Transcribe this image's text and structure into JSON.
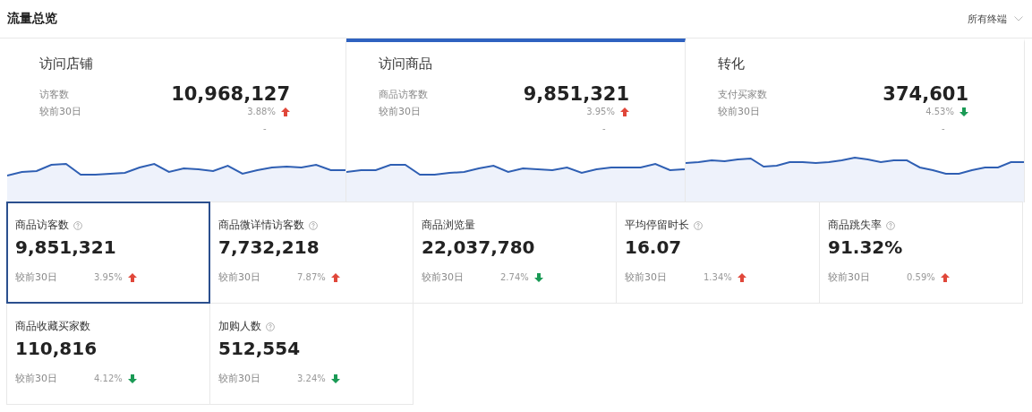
{
  "header": {
    "title": "流量总览",
    "filter": "所有终端"
  },
  "tabs": [
    {
      "title": "访问店铺",
      "metric": "访客数",
      "value": "10,968,127",
      "compare": "较前30日",
      "change": "3.88%",
      "rising": true,
      "note": "-",
      "selected": false
    },
    {
      "title": "访问商品",
      "metric": "商品访客数",
      "value": "9,851,321",
      "compare": "较前30日",
      "change": "3.95%",
      "rising": true,
      "note": "-",
      "selected": true
    },
    {
      "title": "转化",
      "metric": "支付买家数",
      "value": "374,601",
      "compare": "较前30日",
      "change": "4.53%",
      "rising": false,
      "note": "-",
      "selected": false
    }
  ],
  "metrics": [
    {
      "name": "商品访客数",
      "help": true,
      "value": "9,851,321",
      "compare": "较前30日",
      "change": "3.95%",
      "rising": true,
      "selected": true
    },
    {
      "name": "商品微详情访客数",
      "help": true,
      "value": "7,732,218",
      "compare": "较前30日",
      "change": "7.87%",
      "rising": true,
      "selected": false
    },
    {
      "name": "商品浏览量",
      "help": false,
      "value": "22,037,780",
      "compare": "较前30日",
      "change": "2.74%",
      "rising": false,
      "selected": false
    },
    {
      "name": "平均停留时长",
      "help": true,
      "value": "16.07",
      "compare": "较前30日",
      "change": "1.34%",
      "rising": true,
      "selected": false
    },
    {
      "name": "商品跳失率",
      "help": true,
      "value": "91.32%",
      "compare": "较前30日",
      "change": "0.59%",
      "rising": true,
      "selected": false
    },
    {
      "name": "商品收藏买家数",
      "help": false,
      "value": "110,816",
      "compare": "较前30日",
      "change": "4.12%",
      "rising": false,
      "selected": false
    },
    {
      "name": "加购人数",
      "help": true,
      "value": "512,554",
      "compare": "较前30日",
      "change": "3.24%",
      "rising": false,
      "selected": false
    }
  ]
}
